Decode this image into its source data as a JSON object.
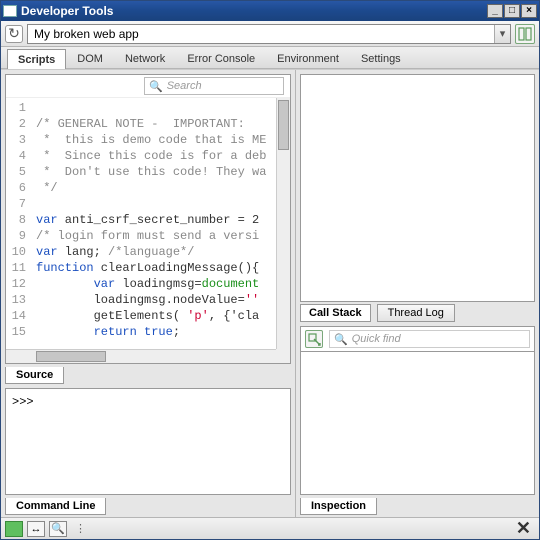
{
  "window": {
    "title": "Developer Tools"
  },
  "url": {
    "value": "My broken web app"
  },
  "tabs": [
    "Scripts",
    "DOM",
    "Network",
    "Error Console",
    "Environment",
    "Settings"
  ],
  "activeTab": 0,
  "search": {
    "placeholder": "Search"
  },
  "source": {
    "label": "Source",
    "lines": [
      "",
      "/* GENERAL NOTE -  IMPORTANT:",
      " *  this is demo code that is ME",
      " *  Since this code is for a deb",
      " *  Don't use this code! They wa",
      " */",
      "",
      "var anti_csrf_secret_number = 2",
      "/* login form must send a versi",
      "var lang; /*language*/",
      "function clearLoadingMessage(){",
      "        var loadingmsg=document",
      "        loadingmsg.nodeValue=''",
      "        getElements( 'p', {'cla",
      "        return true;"
    ]
  },
  "cmdline": {
    "label": "Command Line",
    "prompt": ">>>"
  },
  "callstack": {
    "tab1": "Call Stack",
    "tab2": "Thread Log"
  },
  "quickfind": {
    "placeholder": "Quick find"
  },
  "inspection": {
    "label": "Inspection"
  }
}
